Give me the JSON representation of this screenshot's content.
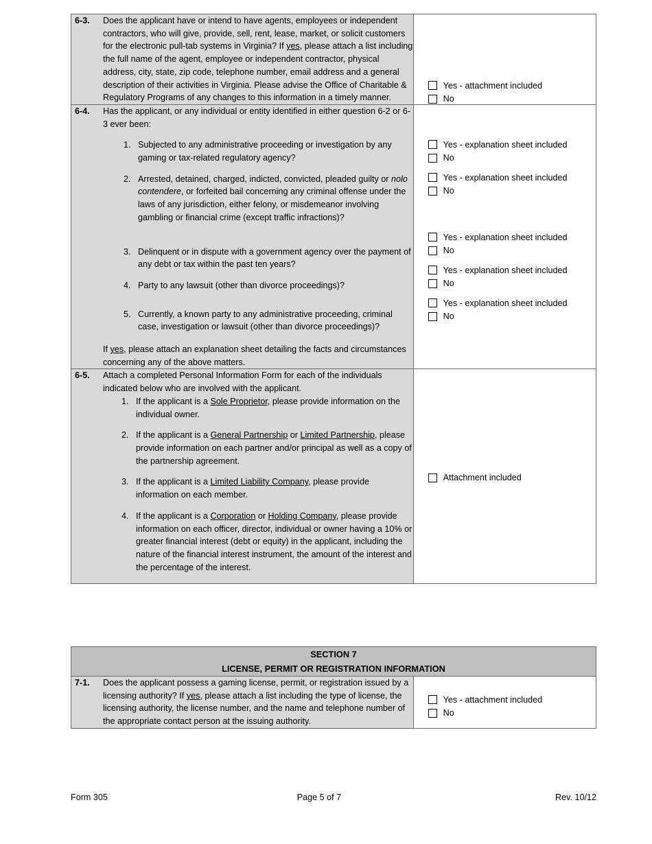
{
  "document": {
    "form_id": "Form 305",
    "page_label": "Page 5 of 7",
    "revision": "Rev. 10/12"
  },
  "colors": {
    "question_cell_bg": "#d9d9d9",
    "answer_cell_bg": "#ffffff",
    "section_header_bg": "#bfbfbf",
    "border": "#6b6b6b",
    "text": "#000000"
  },
  "questions": [
    {
      "number": "6-3.",
      "text_part_1": "Does the applicant have or intend to have agents, employees or independent contractors, who will give, provide, sell, rent, lease, market, or solicit customers for the electronic pull-tab systems in Virginia?  If ",
      "underlined_word": "yes",
      "text_part_2": ", please attach a list including the full name of the agent, employee or independent contractor, physical address, city, state, zip code, telephone number, email address and a general description of their activities in Virginia.  Please advise the Office of Charitable & Regulatory Programs of any changes to this information in a timely manner.",
      "checkbox_groups": [
        {
          "yes_label": "Yes - attachment included",
          "no_label": "No"
        }
      ]
    },
    {
      "number": "6-4.",
      "intro": "Has the applicant, or any individual or entity identified in either question 6-2 or 6-3 ever been:",
      "items": [
        {
          "marker": "1.",
          "text": "Subjected to any administrative proceeding or investigation by any gaming or tax-related regulatory agency?"
        },
        {
          "marker": "2.",
          "text_a": "Arrested, detained, charged, indicted, convicted, pleaded guilty or ",
          "italic": "nolo contendere",
          "text_b": ", or forfeited bail concerning any criminal offense under the laws of any jurisdiction, either felony, or misdemeanor involving gambling or financial crime (except traffic infractions)?"
        },
        {
          "marker": "3.",
          "text": "Delinquent or in dispute with a government agency over the payment of any debt or tax within the past ten years?"
        },
        {
          "marker": "4.",
          "text": "Party to any lawsuit (other than divorce proceedings)?"
        },
        {
          "marker": "5.",
          "text": "Currently, a known party to any administrative proceeding, criminal case, investigation or lawsuit (other than divorce proceedings)?"
        }
      ],
      "closing_part_1": "If ",
      "closing_underlined": "yes",
      "closing_part_2": ", please attach an explanation sheet detailing the facts and circumstances concerning any of the above matters.",
      "checkbox_groups": [
        {
          "yes_label": "Yes - explanation sheet included",
          "no_label": "No"
        },
        {
          "yes_label": "Yes - explanation sheet included",
          "no_label": "No"
        },
        {
          "yes_label": "Yes - explanation sheet included",
          "no_label": "No"
        },
        {
          "yes_label": "Yes - explanation sheet included",
          "no_label": "No"
        },
        {
          "yes_label": "Yes - explanation sheet included",
          "no_label": "No"
        }
      ]
    },
    {
      "number": "6-5.",
      "intro": "Attach a completed Personal Information Form for each of the individuals indicated below who are involved with the applicant.",
      "items": [
        {
          "marker": "1.",
          "lead": "If the applicant is a ",
          "u1": "Sole Proprietor",
          "tail": ", please provide information on the individual owner."
        },
        {
          "marker": "2.",
          "lead": "If the applicant is a ",
          "u1": "General Partnership",
          "mid": " or ",
          "u2": "Limited Partnership",
          "tail": ", please provide information on each partner and/or principal as well as a copy of the partnership agreement."
        },
        {
          "marker": "3.",
          "lead": "If the applicant is a ",
          "u1": "Limited Liability Company",
          "tail": ", please provide information on each member."
        },
        {
          "marker": "4.",
          "lead": "If the applicant is a ",
          "u1": "Corporation",
          "mid": " or ",
          "u2": "Holding Company",
          "tail": ", please provide information on each officer, director, individual or owner having a 10% or greater financial interest (debt or equity) in the applicant, including the nature of the financial interest instrument, the amount of the interest and the percentage of the interest."
        }
      ],
      "checkbox_single_label": "Attachment included"
    }
  ],
  "section7": {
    "header_line1": "SECTION 7",
    "header_line2": "LICENSE, PERMIT OR REGISTRATION INFORMATION",
    "question": {
      "number": "7-1.",
      "text_part_1": "Does the applicant possess a gaming license, permit, or registration issued by a licensing authority?  If ",
      "underlined_word": "yes",
      "text_part_2": ", please attach a list including the type of license, the licensing authority, the license number, and the name and telephone number of the appropriate contact person at the issuing authority.",
      "checkbox_groups": [
        {
          "yes_label": "Yes - attachment included",
          "no_label": "No"
        }
      ]
    }
  }
}
